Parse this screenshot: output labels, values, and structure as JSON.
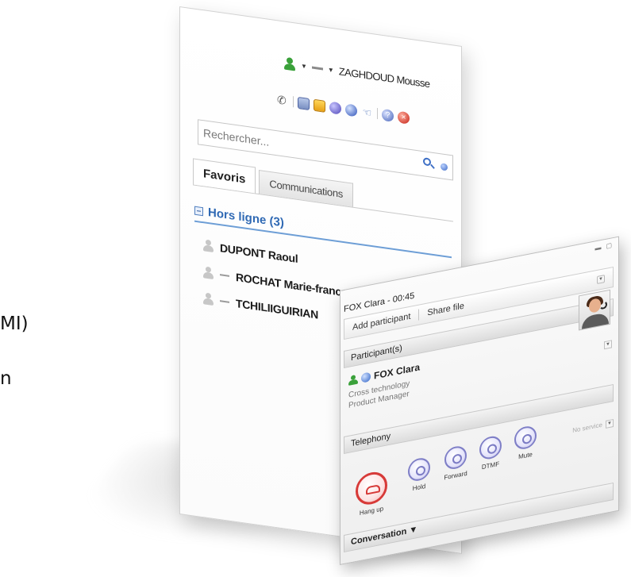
{
  "left_text": {
    "line1": "MI)",
    "line2": "n"
  },
  "contact_window": {
    "user_name": "ZAGHDOUD Mousse",
    "search_placeholder": "Rechercher...",
    "tabs": [
      {
        "label": "Favoris",
        "active": true
      },
      {
        "label": "Communications",
        "active": false
      }
    ],
    "group": {
      "label": "Hors ligne (3)"
    },
    "contacts": [
      {
        "name": "DUPONT Raoul"
      },
      {
        "name": "ROCHAT Marie-france"
      },
      {
        "name": "TCHILIIGUIRIAN"
      }
    ],
    "toolbar_icons": [
      "phone-icon",
      "contact-card-icon",
      "mail-icon",
      "globe-icon",
      "presence-ball-icon",
      "hand-icon",
      "help-icon",
      "close-icon"
    ]
  },
  "communication_window": {
    "title": "FOX Clara - 00:45",
    "actions": {
      "add": "Add participant",
      "share": "Share file"
    },
    "participants_header": "Participant(s)",
    "participant": {
      "name": "FOX Clara",
      "company": "Cross technology",
      "role": "Product Manager"
    },
    "telephony_header": "Telephony",
    "telephony_buttons": [
      {
        "label": "Hang up"
      },
      {
        "label": "Hold"
      },
      {
        "label": "Forward"
      },
      {
        "label": "DTMF"
      },
      {
        "label": "Mute"
      }
    ],
    "no_service": "No service",
    "conversation_label": "Conversation ▼"
  },
  "colors": {
    "accent_blue": "#2f69b4",
    "hangup_red": "#d73a38",
    "online_green": "#3aa13a",
    "call_button_purple": "#7f7fc7"
  }
}
